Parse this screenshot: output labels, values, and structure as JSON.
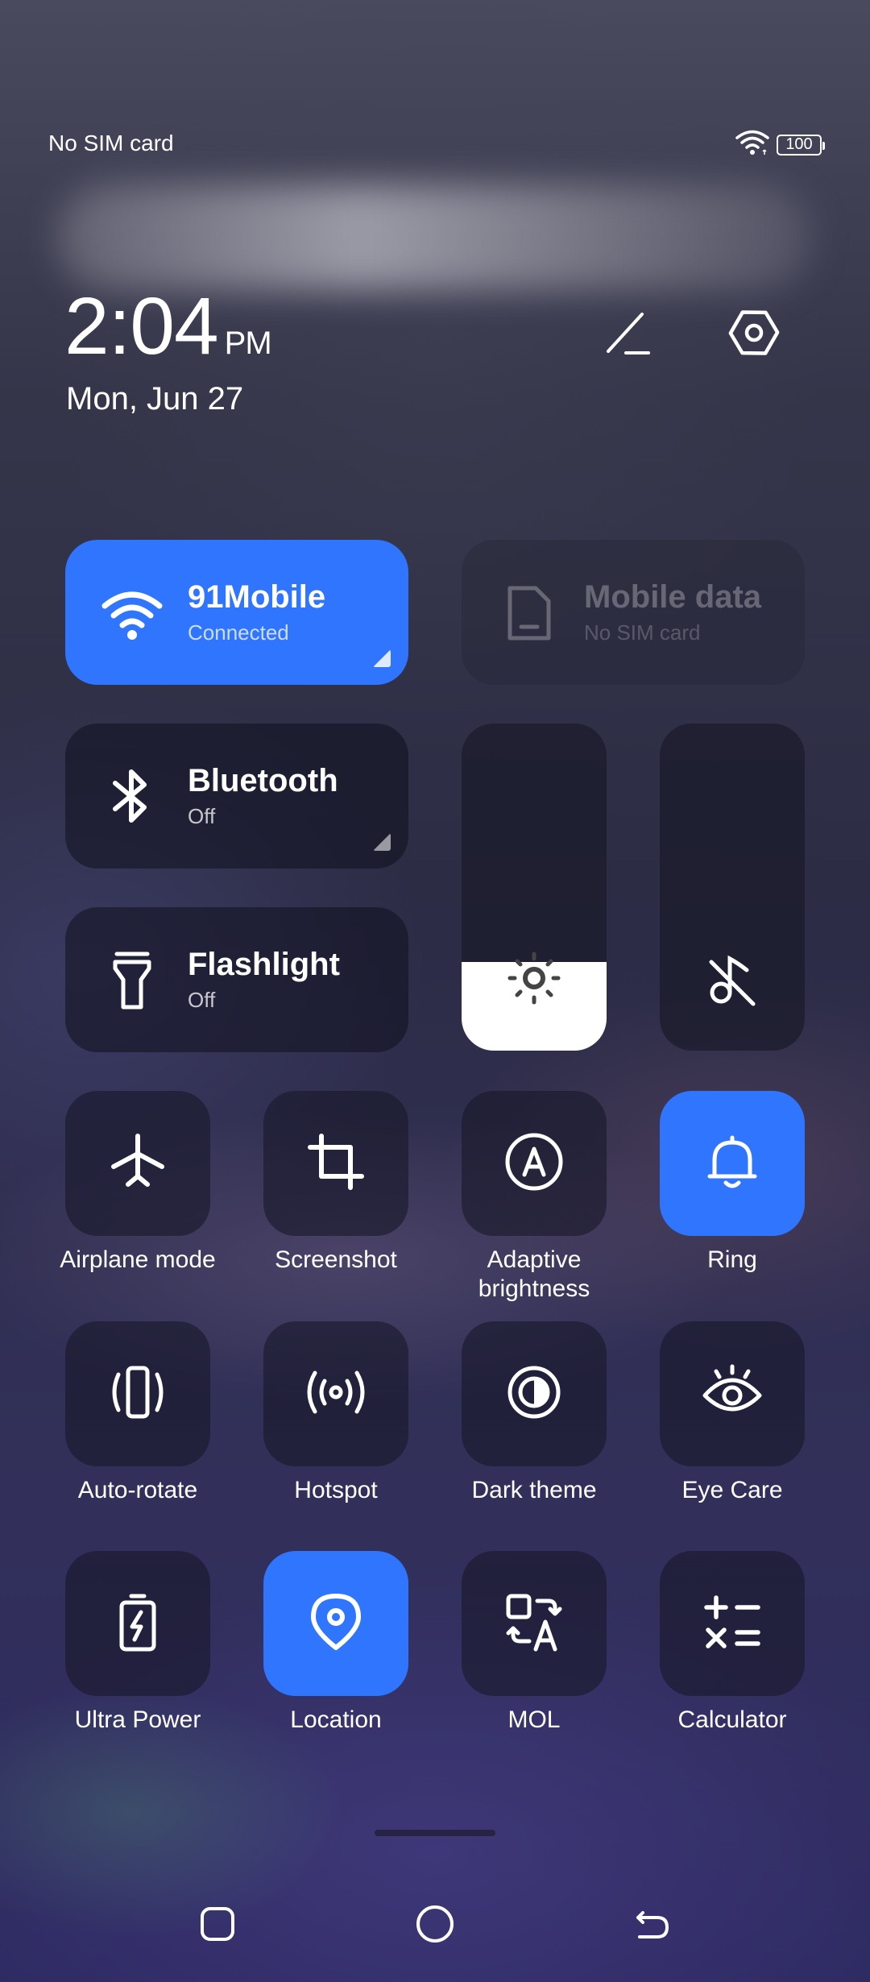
{
  "status_bar": {
    "carrier": "No SIM card",
    "battery": "100",
    "icons": [
      "wifi-icon",
      "battery-icon"
    ]
  },
  "clock": {
    "time": "2:04",
    "ampm": "PM",
    "date": "Mon, Jun 27"
  },
  "header_icons": [
    "edit-icon",
    "settings-icon"
  ],
  "wide_tiles": {
    "wifi": {
      "title": "91Mobile",
      "subtitle": "Connected",
      "icon": "wifi-icon",
      "active": true
    },
    "mobile_data": {
      "title": "Mobile data",
      "subtitle": "No SIM card",
      "icon": "sim-card-icon",
      "active": false
    },
    "bluetooth": {
      "title": "Bluetooth",
      "subtitle": "Off",
      "icon": "bluetooth-icon",
      "active": false
    },
    "flashlight": {
      "title": "Flashlight",
      "subtitle": "Off",
      "icon": "flashlight-icon",
      "active": false
    }
  },
  "sliders": {
    "brightness": {
      "level_percent": 27,
      "icon": "brightness-icon"
    },
    "volume": {
      "level_percent": 0,
      "icon": "mute-icon"
    }
  },
  "toggles": [
    {
      "label": "Airplane mode",
      "icon": "airplane-icon",
      "active": false
    },
    {
      "label": "Screenshot",
      "icon": "crop-icon",
      "active": false
    },
    {
      "label": "Adaptive brightness",
      "icon": "auto-brightness-icon",
      "active": false
    },
    {
      "label": "Ring",
      "icon": "bell-icon",
      "active": true
    },
    {
      "label": "Auto-rotate",
      "icon": "rotate-icon",
      "active": false
    },
    {
      "label": "Hotspot",
      "icon": "hotspot-icon",
      "active": false
    },
    {
      "label": "Dark theme",
      "icon": "dark-theme-icon",
      "active": false
    },
    {
      "label": "Eye Care",
      "icon": "eye-icon",
      "active": false
    },
    {
      "label": "Ultra Power",
      "icon": "battery-bolt-icon",
      "active": false
    },
    {
      "label": "Location",
      "icon": "location-pin-icon",
      "active": true
    },
    {
      "label": "MOL",
      "icon": "translate-icon",
      "active": false
    },
    {
      "label": "Calculator",
      "icon": "calculator-icon",
      "active": false
    }
  ],
  "nav_bar": [
    "recents-icon",
    "home-icon",
    "back-icon"
  ],
  "colors": {
    "accent": "#2f75fe",
    "tile": "#1c1c2e"
  }
}
